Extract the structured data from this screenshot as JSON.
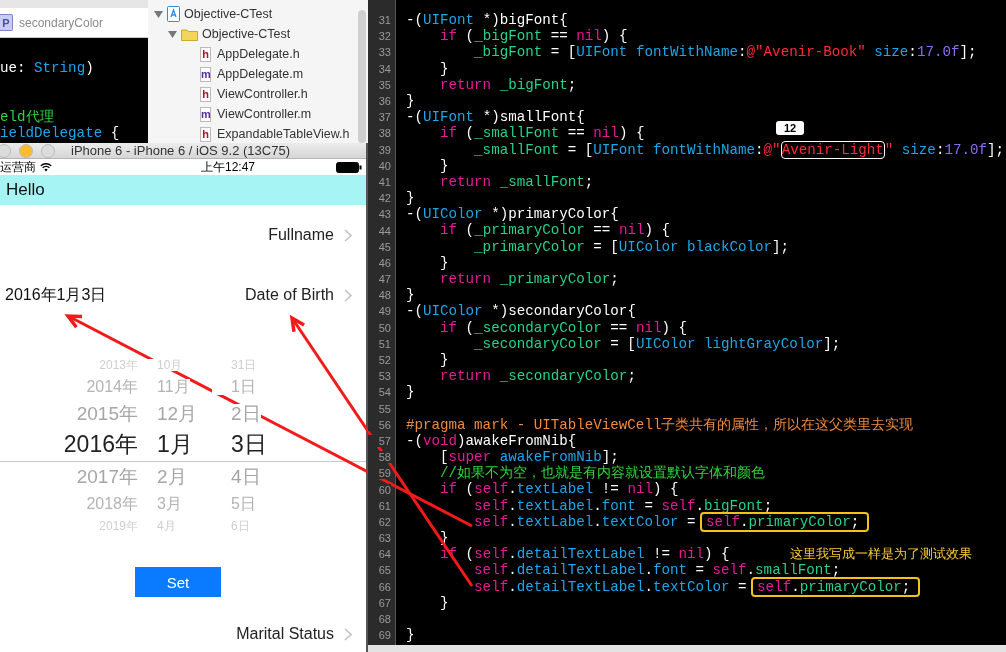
{
  "side_editor": {
    "tab": {
      "badge": "P",
      "label": "secondaryColor"
    },
    "lines": [
      {
        "tokens": [
          {
            "kind": "plain",
            "text": "ue: "
          },
          {
            "kind": "type",
            "text": "String"
          },
          {
            "kind": "plain",
            "text": ")"
          }
        ]
      },
      {
        "tokens": [
          {
            "kind": "comment",
            "text": "eld代理"
          }
        ]
      },
      {
        "tokens": [
          {
            "kind": "type",
            "text": "ieldDelegate"
          },
          {
            "kind": "plain",
            "text": " {"
          }
        ]
      }
    ]
  },
  "navigator": {
    "tree": [
      {
        "label": "Objective-CTest",
        "kind": "project",
        "expanded": true,
        "children": [
          {
            "label": "Objective-CTest",
            "kind": "folder",
            "expanded": true,
            "children": [
              {
                "label": "AppDelegate.h",
                "kind": "file",
                "badge": "h"
              },
              {
                "label": "AppDelegate.m",
                "kind": "file",
                "badge": "m"
              },
              {
                "label": "ViewController.h",
                "kind": "file",
                "badge": "h"
              },
              {
                "label": "ViewController.m",
                "kind": "file",
                "badge": "m"
              },
              {
                "label": "ExpandableTableView.h",
                "kind": "file",
                "badge": "h"
              }
            ]
          }
        ]
      }
    ]
  },
  "simulator": {
    "title": "iPhone 6 - iPhone 6 / iOS 9.2 (13C75)",
    "status_bar": {
      "carrier": "运营商",
      "time": "上午12:47"
    },
    "nav_title": "Hello",
    "cells_top": [
      {
        "label": "Fullname"
      },
      {
        "label": "Date of Birth",
        "value": "2016年1月3日"
      }
    ],
    "picker": {
      "rows": [
        {
          "year": "2013年",
          "month": "10月",
          "day": "31日",
          "selected": false
        },
        {
          "year": "2014年",
          "month": "11月",
          "day": "1日",
          "selected": false
        },
        {
          "year": "2015年",
          "month": "12月",
          "day": "2日",
          "selected": false
        },
        {
          "year": "2016年",
          "month": "1月",
          "day": "3日",
          "selected": true
        },
        {
          "year": "2017年",
          "month": "2月",
          "day": "4日",
          "selected": false
        },
        {
          "year": "2018年",
          "month": "3月",
          "day": "5日",
          "selected": false
        },
        {
          "year": "2019年",
          "month": "4月",
          "day": "6日",
          "selected": false
        }
      ]
    },
    "set_button": "Set",
    "cells_bottom": [
      {
        "label": "Marital Status"
      }
    ]
  },
  "code_editor": {
    "search_badge": "12",
    "note": "这里我写成一样是为了测试效果",
    "lines": [
      {
        "number": "31",
        "tokens": [
          {
            "kind": "plain",
            "text": "-("
          },
          {
            "kind": "type",
            "text": "UIFont"
          },
          {
            "kind": "plain",
            "text": " *)bigFont{"
          }
        ]
      },
      {
        "number": "32",
        "tokens": [
          {
            "kind": "kw",
            "text": "    if"
          },
          {
            "kind": "plain",
            "text": " ("
          },
          {
            "kind": "ivar",
            "text": "_bigFont"
          },
          {
            "kind": "plain",
            "text": " == "
          },
          {
            "kind": "kw",
            "text": "nil"
          },
          {
            "kind": "plain",
            "text": ") {"
          }
        ]
      },
      {
        "number": "33",
        "tokens": [
          {
            "kind": "ivar",
            "text": "        _bigFont"
          },
          {
            "kind": "plain",
            "text": " = ["
          },
          {
            "kind": "type",
            "text": "UIFont fontWithName"
          },
          {
            "kind": "plain",
            "text": ":"
          },
          {
            "kind": "string",
            "text": "@\"Avenir-Book\""
          },
          {
            "kind": "type",
            "text": " size"
          },
          {
            "kind": "plain",
            "text": ":"
          },
          {
            "kind": "number",
            "text": "17.0f"
          },
          {
            "kind": "plain",
            "text": "];"
          }
        ]
      },
      {
        "number": "34",
        "tokens": [
          {
            "kind": "plain",
            "text": "    }"
          }
        ]
      },
      {
        "number": "35",
        "tokens": [
          {
            "kind": "kw",
            "text": "    return"
          },
          {
            "kind": "ivar",
            "text": " _bigFont"
          },
          {
            "kind": "plain",
            "text": ";"
          }
        ]
      },
      {
        "number": "36",
        "tokens": [
          {
            "kind": "plain",
            "text": "}"
          }
        ]
      },
      {
        "number": "37",
        "tokens": [
          {
            "kind": "plain",
            "text": "-("
          },
          {
            "kind": "type",
            "text": "UIFont"
          },
          {
            "kind": "plain",
            "text": " *)smallFont{"
          }
        ]
      },
      {
        "number": "38",
        "tokens": [
          {
            "kind": "kw",
            "text": "    if"
          },
          {
            "kind": "plain",
            "text": " ("
          },
          {
            "kind": "ivar",
            "text": "_smallFont"
          },
          {
            "kind": "plain",
            "text": " == "
          },
          {
            "kind": "kw",
            "text": "nil"
          },
          {
            "kind": "plain",
            "text": ") {"
          }
        ]
      },
      {
        "number": "39",
        "tokens": [
          {
            "kind": "ivar",
            "text": "        _smallFont"
          },
          {
            "kind": "plain",
            "text": " = ["
          },
          {
            "kind": "type",
            "text": "UIFont fontWithName"
          },
          {
            "kind": "plain",
            "text": ":"
          },
          {
            "kind": "string",
            "text": "@\""
          },
          {
            "kind": "string",
            "text": "Avenir-Light",
            "boxed": true,
            "color": "#ffffff"
          },
          {
            "kind": "string",
            "text": "\""
          },
          {
            "kind": "type",
            "text": " size"
          },
          {
            "kind": "plain",
            "text": ":"
          },
          {
            "kind": "number",
            "text": "17.0f"
          },
          {
            "kind": "plain",
            "text": "];"
          }
        ]
      },
      {
        "number": "40",
        "tokens": [
          {
            "kind": "plain",
            "text": "    }"
          }
        ]
      },
      {
        "number": "41",
        "tokens": [
          {
            "kind": "kw",
            "text": "    return"
          },
          {
            "kind": "ivar",
            "text": " _smallFont"
          },
          {
            "kind": "plain",
            "text": ";"
          }
        ]
      },
      {
        "number": "42",
        "tokens": [
          {
            "kind": "plain",
            "text": "}"
          }
        ]
      },
      {
        "number": "43",
        "tokens": [
          {
            "kind": "plain",
            "text": "-("
          },
          {
            "kind": "type",
            "text": "UIColor"
          },
          {
            "kind": "plain",
            "text": " *)primaryColor{"
          }
        ]
      },
      {
        "number": "44",
        "tokens": [
          {
            "kind": "kw",
            "text": "    if"
          },
          {
            "kind": "plain",
            "text": " ("
          },
          {
            "kind": "ivar",
            "text": "_primaryColor"
          },
          {
            "kind": "plain",
            "text": " == "
          },
          {
            "kind": "kw",
            "text": "nil"
          },
          {
            "kind": "plain",
            "text": ") {"
          }
        ]
      },
      {
        "number": "45",
        "tokens": [
          {
            "kind": "ivar",
            "text": "        _primaryColor"
          },
          {
            "kind": "plain",
            "text": " = ["
          },
          {
            "kind": "type",
            "text": "UIColor blackColor"
          },
          {
            "kind": "plain",
            "text": "];"
          }
        ]
      },
      {
        "number": "46",
        "tokens": [
          {
            "kind": "plain",
            "text": "    }"
          }
        ]
      },
      {
        "number": "47",
        "tokens": [
          {
            "kind": "kw",
            "text": "    return"
          },
          {
            "kind": "ivar",
            "text": " _primaryColor"
          },
          {
            "kind": "plain",
            "text": ";"
          }
        ]
      },
      {
        "number": "48",
        "tokens": [
          {
            "kind": "plain",
            "text": "}"
          }
        ]
      },
      {
        "number": "49",
        "tokens": [
          {
            "kind": "plain",
            "text": "-("
          },
          {
            "kind": "type",
            "text": "UIColor"
          },
          {
            "kind": "plain",
            "text": " *)secondaryColor{"
          }
        ]
      },
      {
        "number": "50",
        "tokens": [
          {
            "kind": "kw",
            "text": "    if"
          },
          {
            "kind": "plain",
            "text": " ("
          },
          {
            "kind": "ivar",
            "text": "_secondaryColor"
          },
          {
            "kind": "plain",
            "text": " == "
          },
          {
            "kind": "kw",
            "text": "nil"
          },
          {
            "kind": "plain",
            "text": ") {"
          }
        ]
      },
      {
        "number": "51",
        "tokens": [
          {
            "kind": "ivar",
            "text": "        _secondaryColor"
          },
          {
            "kind": "plain",
            "text": " = ["
          },
          {
            "kind": "type",
            "text": "UIColor lightGrayColor"
          },
          {
            "kind": "plain",
            "text": "];"
          }
        ]
      },
      {
        "number": "52",
        "tokens": [
          {
            "kind": "plain",
            "text": "    }"
          }
        ]
      },
      {
        "number": "53",
        "tokens": [
          {
            "kind": "kw",
            "text": "    return"
          },
          {
            "kind": "ivar",
            "text": " _secondaryColor"
          },
          {
            "kind": "plain",
            "text": ";"
          }
        ]
      },
      {
        "number": "54",
        "tokens": [
          {
            "kind": "plain",
            "text": "}"
          }
        ]
      },
      {
        "number": "55"
      },
      {
        "number": "56",
        "tokens": [
          {
            "kind": "pragma",
            "text": "#pragma mark - UITableViewCell子类共有的属性，所以在这父类里去实现"
          }
        ]
      },
      {
        "number": "57",
        "tokens": [
          {
            "kind": "plain",
            "text": "-("
          },
          {
            "kind": "kw",
            "text": "void"
          },
          {
            "kind": "plain",
            "text": ")awakeFromNib{"
          }
        ]
      },
      {
        "number": "58",
        "tokens": [
          {
            "kind": "plain",
            "text": "    ["
          },
          {
            "kind": "kw",
            "text": "super"
          },
          {
            "kind": "type",
            "text": " awakeFromNib"
          },
          {
            "kind": "plain",
            "text": "];"
          }
        ]
      },
      {
        "number": "59",
        "tokens": [
          {
            "kind": "comment",
            "text": "    //如果不为空，也就是有内容就设置默认字体和颜色"
          }
        ]
      },
      {
        "number": "60",
        "tokens": [
          {
            "kind": "kw",
            "text": "    if"
          },
          {
            "kind": "plain",
            "text": " ("
          },
          {
            "kind": "kw",
            "text": "self"
          },
          {
            "kind": "plain",
            "text": "."
          },
          {
            "kind": "type",
            "text": "textLabel"
          },
          {
            "kind": "plain",
            "text": " != "
          },
          {
            "kind": "kw",
            "text": "nil"
          },
          {
            "kind": "plain",
            "text": ") {"
          }
        ]
      },
      {
        "number": "61",
        "tokens": [
          {
            "kind": "kw",
            "text": "        self"
          },
          {
            "kind": "plain",
            "text": "."
          },
          {
            "kind": "type",
            "text": "textLabel"
          },
          {
            "kind": "plain",
            "text": "."
          },
          {
            "kind": "type",
            "text": "font"
          },
          {
            "kind": "plain",
            "text": " = "
          },
          {
            "kind": "kw",
            "text": "self"
          },
          {
            "kind": "plain",
            "text": "."
          },
          {
            "kind": "ivar",
            "text": "bigFont"
          },
          {
            "kind": "plain",
            "text": ";"
          }
        ]
      },
      {
        "number": "62",
        "tokens": [
          {
            "kind": "kw",
            "text": "        self"
          },
          {
            "kind": "plain",
            "text": "."
          },
          {
            "kind": "type",
            "text": "textLabel"
          },
          {
            "kind": "plain",
            "text": "."
          },
          {
            "kind": "type",
            "text": "textColor"
          },
          {
            "kind": "plain",
            "text": " = "
          },
          {
            "kind": "mixed",
            "text": "self.primaryColor;",
            "boxed": true,
            "color": "#f5c21b"
          }
        ]
      },
      {
        "number": "63",
        "tokens": [
          {
            "kind": "plain",
            "text": "    }"
          }
        ]
      },
      {
        "number": "64",
        "tokens": [
          {
            "kind": "kw",
            "text": "    if"
          },
          {
            "kind": "plain",
            "text": " ("
          },
          {
            "kind": "kw",
            "text": "self"
          },
          {
            "kind": "plain",
            "text": "."
          },
          {
            "kind": "type",
            "text": "detailTextLabel"
          },
          {
            "kind": "plain",
            "text": " != "
          },
          {
            "kind": "kw",
            "text": "nil"
          },
          {
            "kind": "plain",
            "text": ") {"
          }
        ]
      },
      {
        "number": "65",
        "tokens": [
          {
            "kind": "kw",
            "text": "        self"
          },
          {
            "kind": "plain",
            "text": "."
          },
          {
            "kind": "type",
            "text": "detailTextLabel"
          },
          {
            "kind": "plain",
            "text": "."
          },
          {
            "kind": "type",
            "text": "font"
          },
          {
            "kind": "plain",
            "text": " = "
          },
          {
            "kind": "kw",
            "text": "self"
          },
          {
            "kind": "plain",
            "text": "."
          },
          {
            "kind": "ivar",
            "text": "smallFont"
          },
          {
            "kind": "plain",
            "text": ";"
          }
        ]
      },
      {
        "number": "66",
        "tokens": [
          {
            "kind": "kw",
            "text": "        self"
          },
          {
            "kind": "plain",
            "text": "."
          },
          {
            "kind": "type",
            "text": "detailTextLabel"
          },
          {
            "kind": "plain",
            "text": "."
          },
          {
            "kind": "type",
            "text": "textColor"
          },
          {
            "kind": "plain",
            "text": " = "
          },
          {
            "kind": "mixed",
            "text": "self.primaryColor;",
            "boxed": true,
            "color": "#f5c21b"
          }
        ]
      },
      {
        "number": "67",
        "tokens": [
          {
            "kind": "plain",
            "text": "    }"
          }
        ]
      },
      {
        "number": "68"
      },
      {
        "number": "69",
        "tokens": [
          {
            "kind": "plain",
            "text": "}"
          }
        ]
      }
    ]
  }
}
